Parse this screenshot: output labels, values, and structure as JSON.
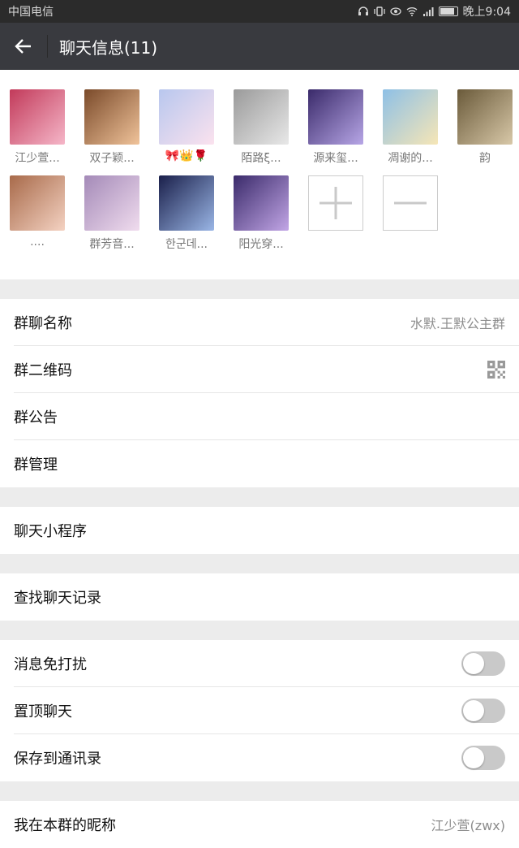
{
  "status": {
    "carrier": "中国电信",
    "time": "晚上9:04"
  },
  "header": {
    "title": "聊天信息(11)"
  },
  "members": [
    {
      "name": "江少萱...",
      "colors": [
        "#c23a5a",
        "#f5b6c8"
      ]
    },
    {
      "name": "双子颖...",
      "colors": [
        "#7a4a2a",
        "#f0c39a"
      ]
    },
    {
      "name": "🎀👑🌹",
      "colors": [
        "#b8c7ee",
        "#fbe2ee"
      ]
    },
    {
      "name": "陌路ξ...",
      "colors": [
        "#9a9a9a",
        "#e8e8e8"
      ]
    },
    {
      "name": "源来玺...",
      "colors": [
        "#3a2a6a",
        "#b7a6e6"
      ]
    },
    {
      "name": "凋谢的...",
      "colors": [
        "#8ec0e6",
        "#f6e6b6"
      ]
    },
    {
      "name": "韵",
      "colors": [
        "#6a5a3a",
        "#d8c8a8"
      ]
    },
    {
      "name": "....",
      "colors": [
        "#a86a4a",
        "#f4d2c2"
      ]
    },
    {
      "name": "群芳音...",
      "colors": [
        "#a48ab8",
        "#f0dcee"
      ]
    },
    {
      "name": "한군데...",
      "colors": [
        "#1a1f4a",
        "#9ab6e6"
      ]
    },
    {
      "name": "阳光穿...",
      "colors": [
        "#3a2a6a",
        "#c2a6e6"
      ]
    }
  ],
  "settings": {
    "group_name_label": "群聊名称",
    "group_name_value": "水默.王默公主群",
    "qr_label": "群二维码",
    "announcement_label": "群公告",
    "manage_label": "群管理",
    "mini_program_label": "聊天小程序",
    "search_history_label": "查找聊天记录",
    "mute_label": "消息免打扰",
    "pin_label": "置顶聊天",
    "save_contacts_label": "保存到通讯录",
    "nickname_label": "我在本群的昵称",
    "nickname_value": "江少萱(zwx)"
  },
  "toggles": {
    "mute": false,
    "pin": false,
    "save_contacts": false
  }
}
